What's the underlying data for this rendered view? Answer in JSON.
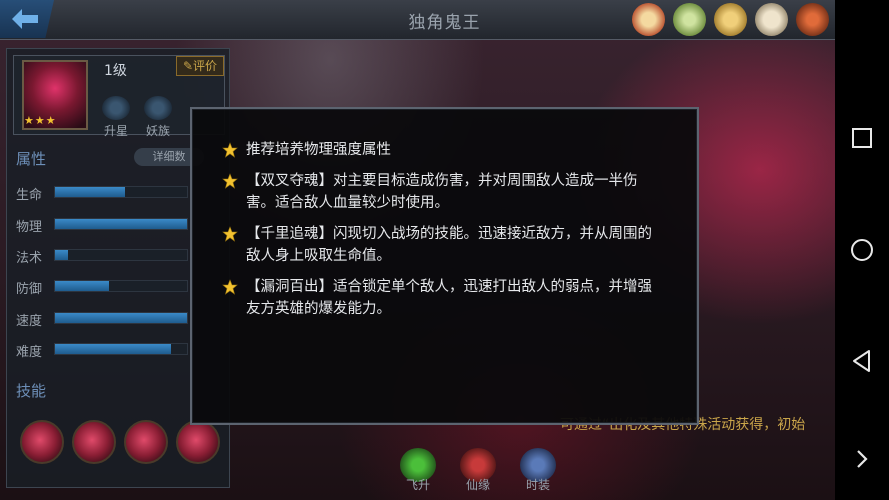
{
  "title": "独角鬼王",
  "hero": {
    "level": "1级",
    "rate_label": "评价",
    "stars": "★★★",
    "star_up_label": "升星",
    "race_label": "妖族"
  },
  "attributes": {
    "heading": "属性",
    "detail_label": "详细数",
    "stats": [
      {
        "label": "生命",
        "value": 0.53
      },
      {
        "label": "物理",
        "value": 1.0
      },
      {
        "label": "法术",
        "value": 0.1
      },
      {
        "label": "防御",
        "value": 0.41
      },
      {
        "label": "速度",
        "value": 1.0
      },
      {
        "label": "难度",
        "value": 0.88
      }
    ]
  },
  "skills": {
    "heading": "技能",
    "icons": [
      "skill-1-icon",
      "skill-2-icon",
      "skill-3-icon",
      "skill-4-icon"
    ]
  },
  "bottom_tabs": [
    "飞升",
    "仙缘",
    "时装"
  ],
  "hint": "可通过“出化及其他特殊活动获得，初始",
  "dialog": {
    "tips": [
      "推荐培养物理强度属性",
      "【双叉夺魂】对主要目标造成伤害，并对周围敌人造成一半伤害。适合敌人血量较少时使用。",
      "【千里追魂】闪现切入战场的技能。迅速接近敌方，并从周围的敌人身上吸取生命值。",
      "【漏洞百出】适合锁定单个敌人，迅速打出敌人的弱点，并增强友方英雄的爆发能力。"
    ]
  },
  "colors": {
    "accent_blue": "#3a8ac8",
    "star_gold": "#f2c230",
    "hint_gold": "#c9a54a"
  },
  "navbar": [
    "square-recent-icon",
    "circle-home-icon",
    "triangle-back-icon",
    "chevron-right-icon"
  ]
}
